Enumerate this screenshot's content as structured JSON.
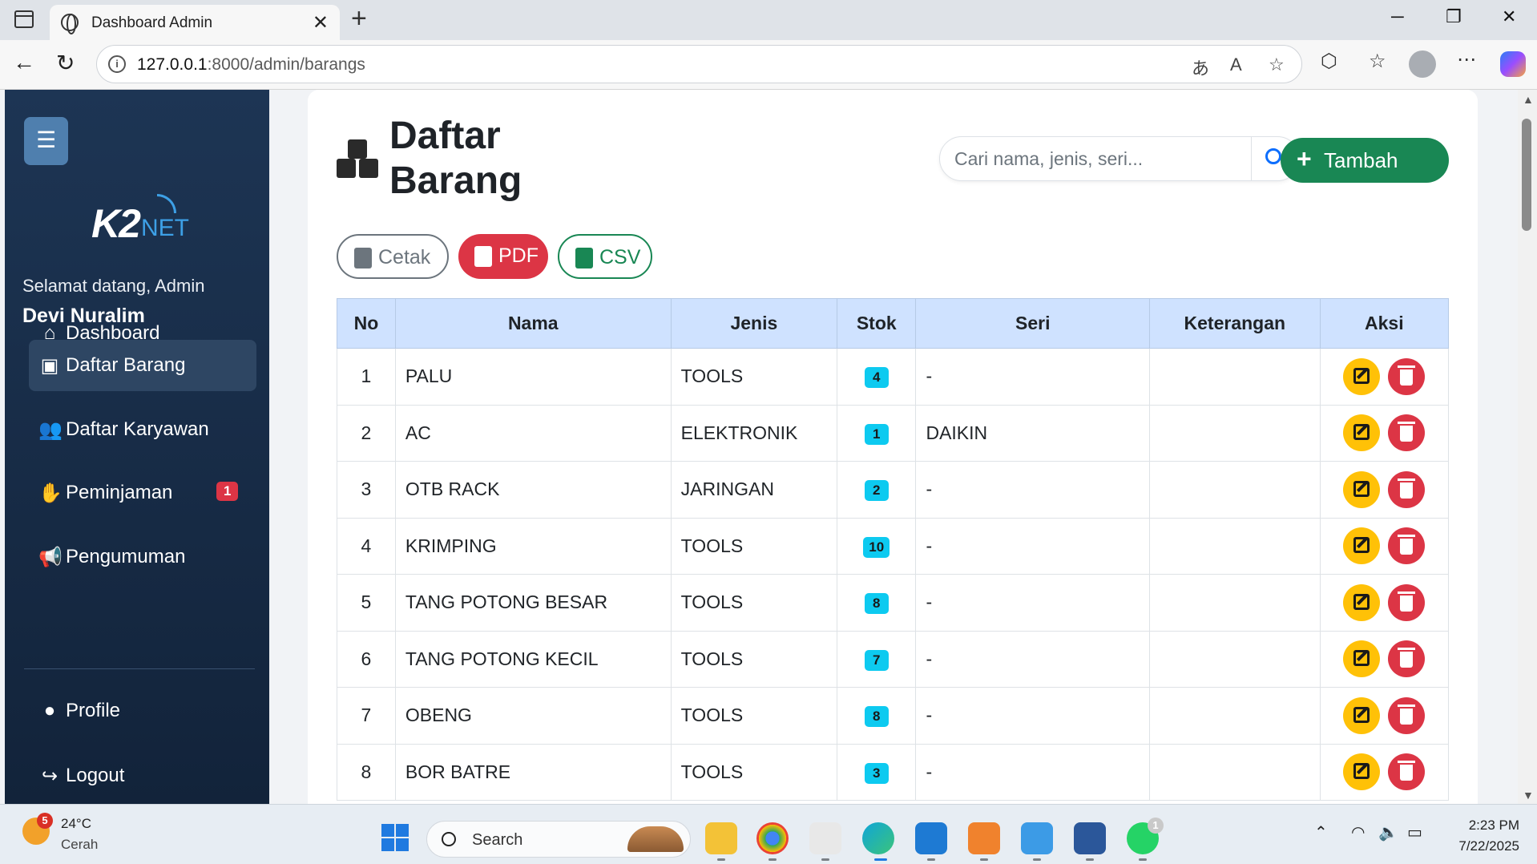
{
  "browser": {
    "tab_title": "Dashboard Admin",
    "url_host": "127.0.0.1",
    "url_rest": ":8000/admin/barangs",
    "close_tab": "✕",
    "new_tab": "+",
    "minimize": "─",
    "restore": "❐",
    "close_window": "✕"
  },
  "sidebar": {
    "menu_toggle": "☰",
    "logo_main": "K2",
    "logo_sub": "NET",
    "welcome": "Selamat datang, Admin",
    "user_name": "Devi Nuralim",
    "items": [
      {
        "label": "Dashboard",
        "icon": "home-icon"
      },
      {
        "label": "Daftar Barang",
        "icon": "box-icon"
      },
      {
        "label": "Daftar Karyawan",
        "icon": "users-icon"
      },
      {
        "label": "Peminjaman",
        "icon": "handshake-icon",
        "badge": "1"
      },
      {
        "label": "Pengumuman",
        "icon": "megaphone-icon"
      },
      {
        "label": "Profile",
        "icon": "user-icon"
      },
      {
        "label": "Logout",
        "icon": "logout-icon"
      }
    ]
  },
  "main": {
    "title": "Daftar Barang",
    "search_placeholder": "Cari nama, jenis, seri...",
    "add_button": "Tambah",
    "export": {
      "print": "Cetak",
      "pdf": "PDF",
      "csv": "CSV"
    },
    "table": {
      "headers": [
        "No",
        "Nama",
        "Jenis",
        "Stok",
        "Seri",
        "Keterangan",
        "Aksi"
      ],
      "rows": [
        {
          "no": "1",
          "nama": "PALU",
          "jenis": "TOOLS",
          "stok": "4",
          "seri": "-",
          "keterangan": ""
        },
        {
          "no": "2",
          "nama": "AC",
          "jenis": "ELEKTRONIK",
          "stok": "1",
          "seri": "DAIKIN",
          "keterangan": ""
        },
        {
          "no": "3",
          "nama": "OTB RACK",
          "jenis": "JARINGAN",
          "stok": "2",
          "seri": "-",
          "keterangan": ""
        },
        {
          "no": "4",
          "nama": "KRIMPING",
          "jenis": "TOOLS",
          "stok": "10",
          "seri": "-",
          "keterangan": ""
        },
        {
          "no": "5",
          "nama": "TANG POTONG BESAR",
          "jenis": "TOOLS",
          "stok": "8",
          "seri": "-",
          "keterangan": ""
        },
        {
          "no": "6",
          "nama": "TANG POTONG KECIL",
          "jenis": "TOOLS",
          "stok": "7",
          "seri": "-",
          "keterangan": ""
        },
        {
          "no": "7",
          "nama": "OBENG",
          "jenis": "TOOLS",
          "stok": "8",
          "seri": "-",
          "keterangan": ""
        },
        {
          "no": "8",
          "nama": "BOR BATRE",
          "jenis": "TOOLS",
          "stok": "3",
          "seri": "-",
          "keterangan": ""
        }
      ]
    }
  },
  "taskbar": {
    "temp": "24°C",
    "condition": "Cerah",
    "weather_badge": "5",
    "search": "Search",
    "whatsapp_badge": "1",
    "time": "2:23 PM",
    "date": "7/22/2025"
  },
  "colors": {
    "sidebar_top": "#1d3554",
    "sidebar_bottom": "#12233a",
    "table_header": "#cfe2ff",
    "success": "#198754",
    "danger": "#dc3545",
    "warning": "#ffc107",
    "info": "#0dcaf0"
  }
}
